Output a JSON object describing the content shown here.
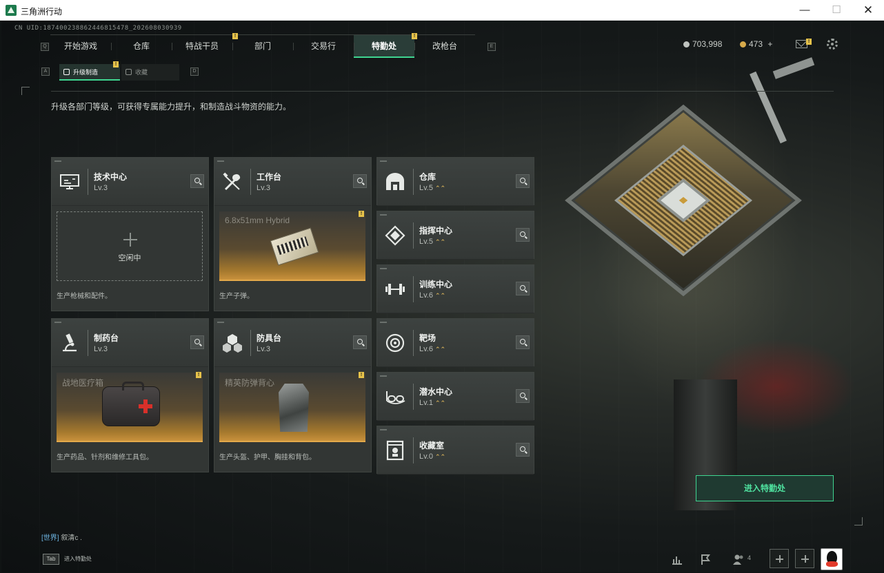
{
  "window": {
    "title": "三角洲行动"
  },
  "uid": "CN UID:1874002388624468154​78_202608030939",
  "nav": {
    "left_key": "Q",
    "right_key": "E",
    "tabs": [
      {
        "label": "开始游戏"
      },
      {
        "label": "仓库"
      },
      {
        "label": "特战干员"
      },
      {
        "label": "部门"
      },
      {
        "label": "交易行"
      },
      {
        "label": "特勤处"
      },
      {
        "label": "改枪台"
      }
    ],
    "active_tab": "特勤处"
  },
  "currency": {
    "silver": "703,998",
    "gold": "473",
    "gold_add": "+"
  },
  "subtabs": {
    "left_key": "A",
    "right_key": "D",
    "upgrade": "升级制造",
    "collection": "收藏"
  },
  "description": "升级各部门等级，可获得专属能力提升，和制造战斗物资的能力。",
  "production": [
    {
      "name": "技术中心",
      "level": "Lv.3",
      "slot_status": "空闲中",
      "slot_item": "",
      "desc": "生产枪械和配件。"
    },
    {
      "name": "工作台",
      "level": "Lv.3",
      "slot_status": "",
      "slot_item": "6.8x51mm Hybrid",
      "desc": "生产子弹。"
    },
    {
      "name": "制药台",
      "level": "Lv.3",
      "slot_status": "",
      "slot_item": "战地医疗箱",
      "desc": "生产药品、针剂和维修工具包。"
    },
    {
      "name": "防具台",
      "level": "Lv.3",
      "slot_status": "",
      "slot_item": "精英防弹背心",
      "desc": "生产头盔、护甲、胸挂和背包。"
    }
  ],
  "facilities": [
    {
      "name": "仓库",
      "level": "Lv.5",
      "icon": "warehouse-icon"
    },
    {
      "name": "指挥中心",
      "level": "Lv.5",
      "icon": "command-center-icon"
    },
    {
      "name": "训练中心",
      "level": "Lv.6",
      "icon": "dumbbell-icon"
    },
    {
      "name": "靶场",
      "level": "Lv.6",
      "icon": "target-icon"
    },
    {
      "name": "潜水中心",
      "level": "Lv.1",
      "icon": "diving-goggles-icon"
    },
    {
      "name": "收藏室",
      "level": "Lv.0",
      "icon": "collection-room-icon"
    }
  ],
  "warn_glyph": "!",
  "upgrade_glyph": "⌃⌃",
  "enter_button": "进入特勤处",
  "chat": {
    "channel": "[世界]",
    "message": " 叙清c ."
  },
  "tab_hint": {
    "key": "Tab",
    "label": "进入特勤处"
  },
  "friends_count": "4",
  "colors": {
    "accent": "#3fd691",
    "gold": "#d8b35a",
    "warning": "#e6c24a"
  }
}
